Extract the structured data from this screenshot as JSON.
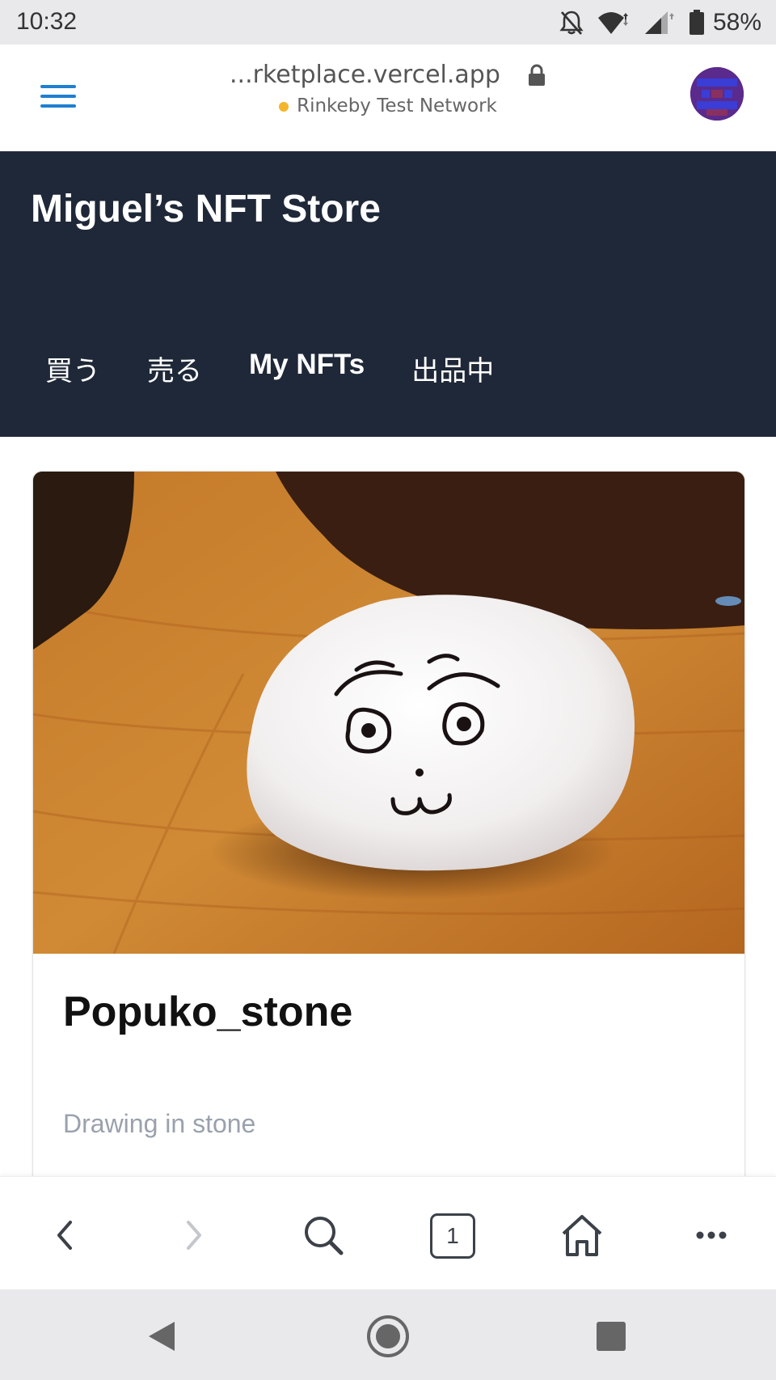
{
  "status_bar": {
    "time": "10:32",
    "battery_percent": "58%",
    "icons": [
      "notifications-off-icon",
      "wifi-icon",
      "signal-icon",
      "battery-icon"
    ]
  },
  "browser": {
    "url": "...rketplace.vercel.app",
    "network": "Rinkeby Test Network",
    "network_dot_color": "#f5b52b",
    "accent_color": "#1f7fd1",
    "tab_count": "1"
  },
  "store": {
    "title": "Miguel’s NFT Store",
    "header_color": "#1f2838",
    "nav": [
      {
        "label": "買う",
        "active": false
      },
      {
        "label": "売る",
        "active": false
      },
      {
        "label": "My NFTs",
        "active": true
      },
      {
        "label": "出品中",
        "active": false
      }
    ]
  },
  "nft": {
    "name": "Popuko_stone",
    "description": "Drawing in stone",
    "image_subject": "white stone with drawn face on wooden table"
  },
  "toolbar_icons": [
    "back-icon",
    "forward-icon",
    "search-icon",
    "tabs-icon",
    "home-icon",
    "more-icon"
  ],
  "android_nav_icons": [
    "android-back-icon",
    "android-home-icon",
    "android-recents-icon"
  ]
}
